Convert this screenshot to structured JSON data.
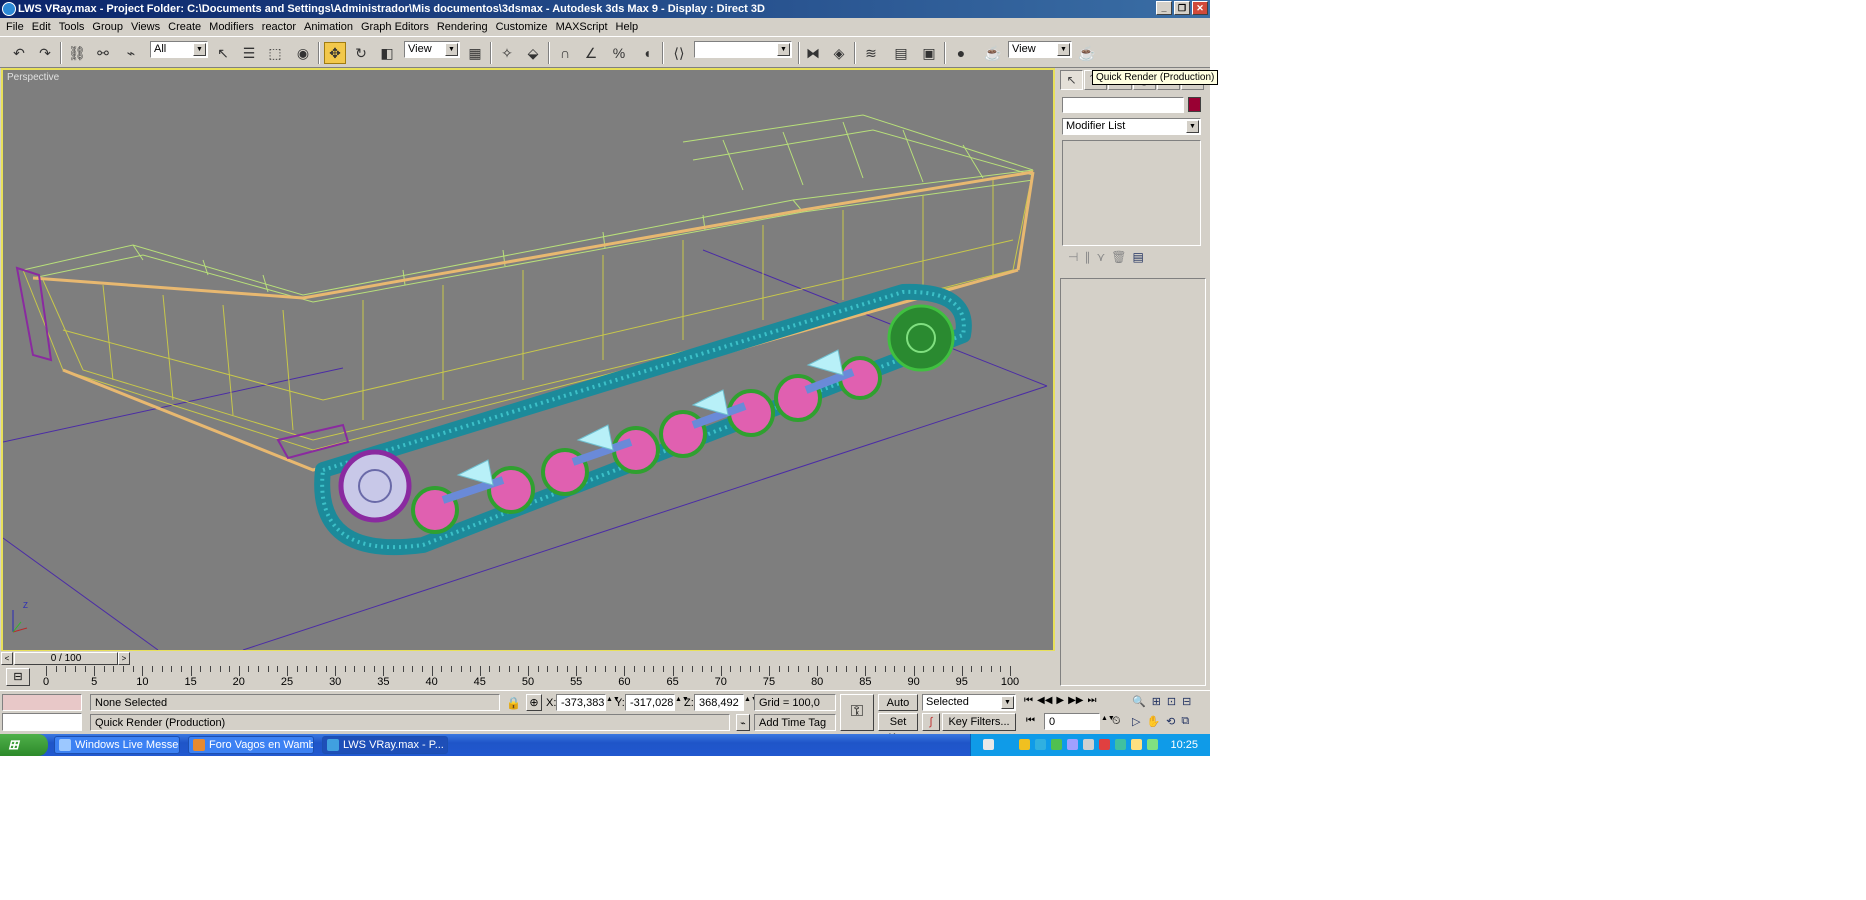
{
  "window": {
    "title": "LWS VRay.max    - Project Folder: C:\\Documents and Settings\\Administrador\\Mis documentos\\3dsmax    - Autodesk 3ds Max 9    - Display : Direct 3D"
  },
  "menu": [
    "File",
    "Edit",
    "Tools",
    "Group",
    "Views",
    "Create",
    "Modifiers",
    "reactor",
    "Animation",
    "Graph Editors",
    "Rendering",
    "Customize",
    "MAXScript",
    "Help"
  ],
  "toolbar": {
    "selection_filter": "All",
    "ref_coord": "View",
    "named_sel": "",
    "view_dropdown": "View",
    "tooltip": "Quick Render (Production)"
  },
  "viewport": {
    "label": "Perspective",
    "axis_label": "Z"
  },
  "command_panel": {
    "modifier_list": "Modifier List",
    "object_color": "#990033"
  },
  "time": {
    "slider": "0 / 100",
    "ticks": [
      "0",
      "5",
      "10",
      "15",
      "20",
      "25",
      "30",
      "35",
      "40",
      "45",
      "50",
      "55",
      "60",
      "65",
      "70",
      "75",
      "80",
      "85",
      "90",
      "95",
      "100"
    ]
  },
  "status": {
    "selection": "None Selected",
    "prompt": "Quick Render (Production)",
    "x_label": "X:",
    "x": "-373,383",
    "y_label": "Y:",
    "y": "-317,028",
    "z_label": "Z:",
    "z": "368,492",
    "grid": "Grid = 100,0",
    "add_time_tag": "Add Time Tag",
    "auto_key": "Auto Key",
    "set_key": "Set Key",
    "key_mode": "Selected",
    "key_filters": "Key Filters...",
    "frame": "0"
  },
  "taskbar": {
    "start": "",
    "tasks": [
      "Windows Live Messen...",
      "Foro Vagos en Wamb...",
      "LWS VRay.max    - P..."
    ],
    "clock": "10:25"
  }
}
